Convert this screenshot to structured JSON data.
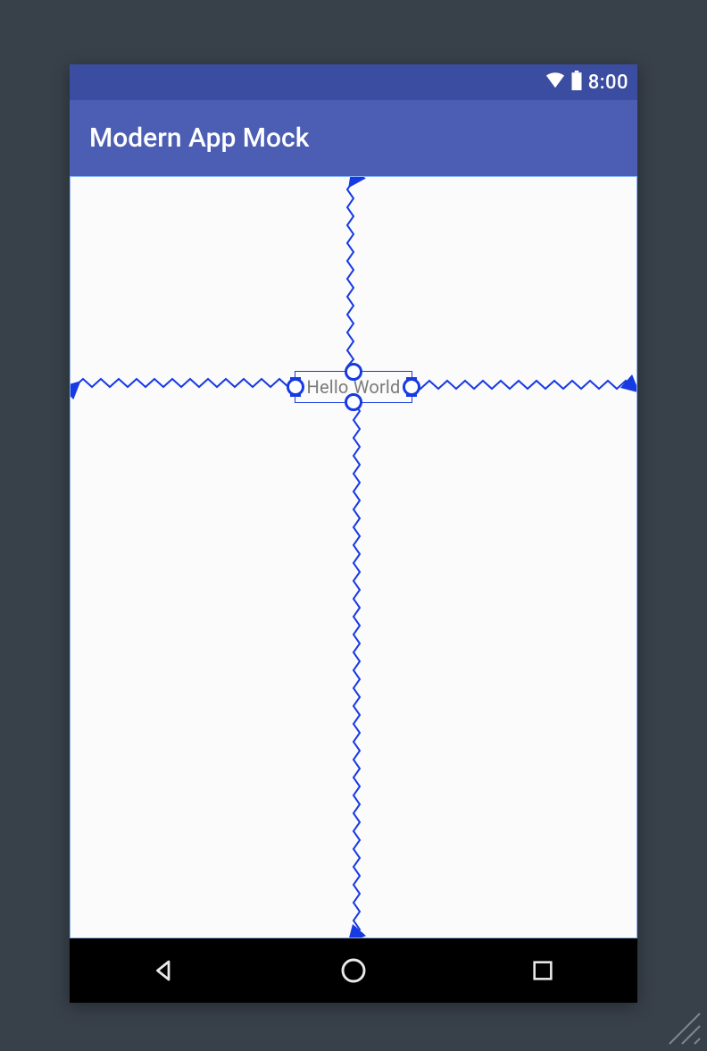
{
  "status": {
    "time": "8:00",
    "icons": {
      "wifi": "wifi-icon",
      "battery": "battery-icon"
    }
  },
  "appbar": {
    "title": "Modern App Mock"
  },
  "canvas": {
    "widget_text": "Hello World",
    "constraint_color": "#173ae2"
  },
  "navbar": {
    "back": "back",
    "home": "home",
    "recents": "recent-apps"
  }
}
